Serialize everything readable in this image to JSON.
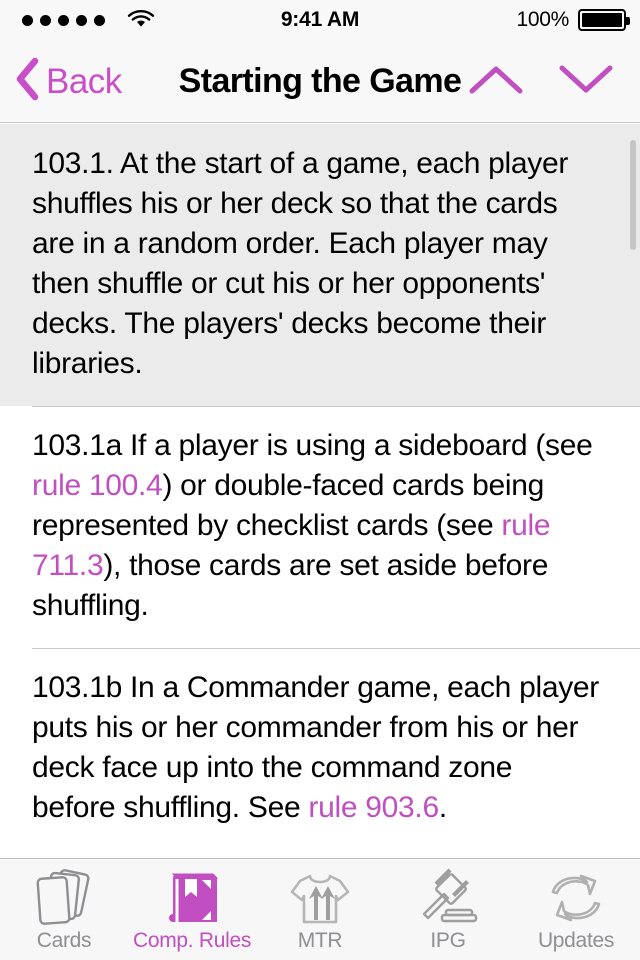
{
  "status_bar": {
    "signal_dots": 5,
    "signal_icon": "signal-dots",
    "wifi_icon": "wifi-icon",
    "time": "9:41 AM",
    "battery_percent": "100%",
    "battery_icon": "battery-full-icon"
  },
  "nav_bar": {
    "back_icon": "chevron-left-icon",
    "back_label": "Back",
    "title": "Starting the Game",
    "prev_icon": "chevron-up-icon",
    "next_icon": "chevron-down-icon",
    "accent_color": "#c94fc9"
  },
  "content": {
    "rules": [
      {
        "highlighted": true,
        "segments": [
          {
            "type": "text",
            "value": "103.1. At the start of a game, each player shuffles his or her deck so that the cards are in a random order. Each player may then shuffle or cut his or her opponents' decks. The players' decks become their libraries."
          }
        ]
      },
      {
        "highlighted": false,
        "segments": [
          {
            "type": "text",
            "value": "103.1a If a player is using a sideboard (see "
          },
          {
            "type": "link",
            "value": "rule 100.4"
          },
          {
            "type": "text",
            "value": ") or double-faced cards being represented by checklist cards (see "
          },
          {
            "type": "link",
            "value": "rule 711.3"
          },
          {
            "type": "text",
            "value": "), those cards are set aside before shuffling."
          }
        ]
      },
      {
        "highlighted": false,
        "segments": [
          {
            "type": "text",
            "value": "103.1b In a Commander game, each player puts his or her commander from his or her deck face up into the command zone before shuffling. See "
          },
          {
            "type": "link",
            "value": "rule 903.6"
          },
          {
            "type": "text",
            "value": "."
          }
        ]
      }
    ],
    "link_color": "#c14fc1",
    "highlight_color": "#ebebeb"
  },
  "tab_bar": {
    "active_index": 1,
    "active_color": "#c14fc1",
    "inactive_color": "#8e8e93",
    "tabs": [
      {
        "label": "Cards",
        "icon": "cards-stack-icon"
      },
      {
        "label": "Comp. Rules",
        "icon": "book-icon"
      },
      {
        "label": "MTR",
        "icon": "tshirt-arrows-icon"
      },
      {
        "label": "IPG",
        "icon": "gavel-icon"
      },
      {
        "label": "Updates",
        "icon": "refresh-arrows-icon"
      }
    ]
  }
}
